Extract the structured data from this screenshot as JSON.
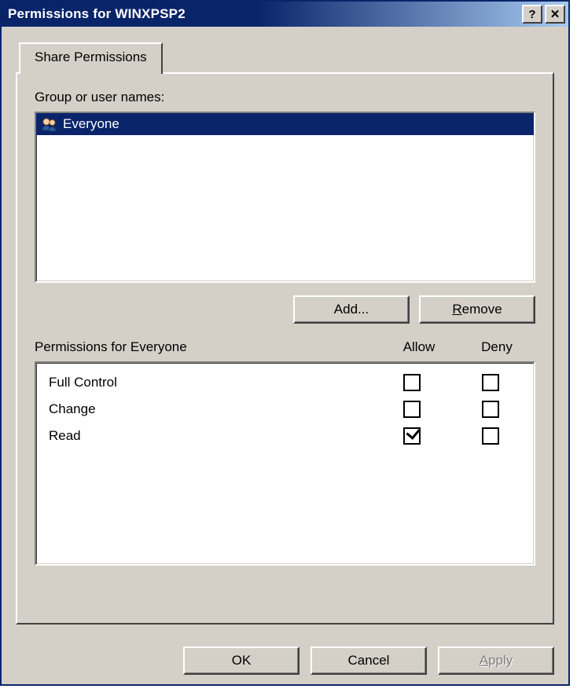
{
  "title": "Permissions for WINXPSP2",
  "tab_label": "Share Permissions",
  "groups_label": "Group or user names:",
  "list": {
    "items": [
      "Everyone"
    ],
    "selected_index": 0
  },
  "buttons": {
    "add": "Add...",
    "remove": "Remove",
    "ok": "OK",
    "cancel": "Cancel",
    "apply": "Apply"
  },
  "perm_section_label": "Permissions for Everyone",
  "perm_columns": {
    "allow": "Allow",
    "deny": "Deny"
  },
  "permissions": [
    {
      "name": "Full Control",
      "allow": false,
      "deny": false
    },
    {
      "name": "Change",
      "allow": false,
      "deny": false
    },
    {
      "name": "Read",
      "allow": true,
      "deny": false
    }
  ]
}
